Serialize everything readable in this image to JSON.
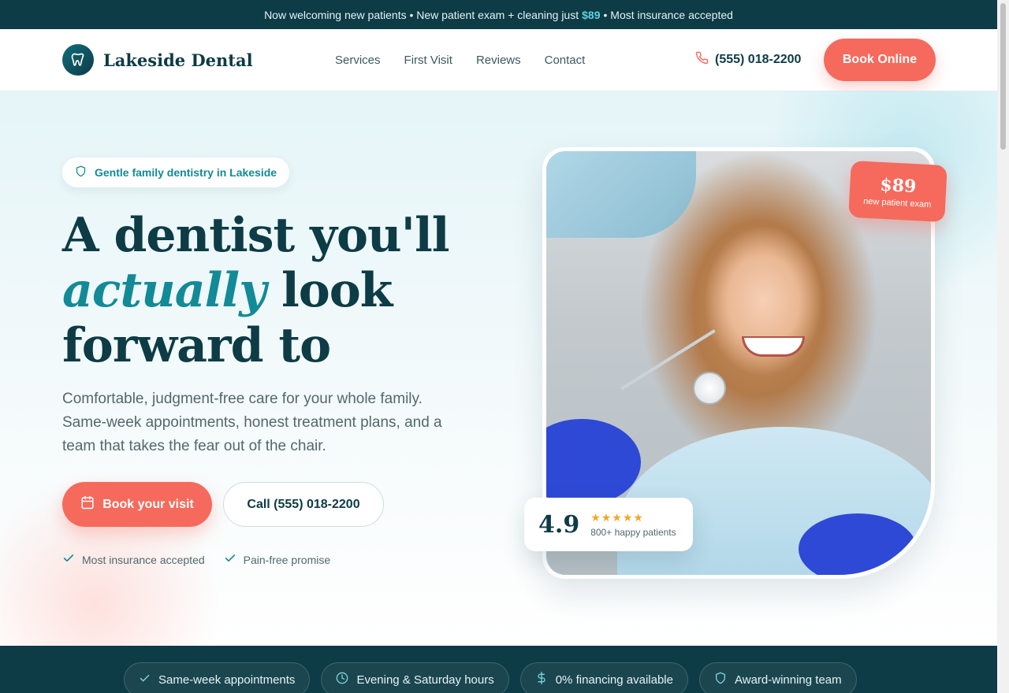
{
  "announcement": {
    "part1": "Now welcoming new patients • New patient exam + cleaning just",
    "price": "$89",
    "part2": "• Most insurance accepted"
  },
  "header": {
    "brand": "Lakeside Dental",
    "nav": [
      "Services",
      "First Visit",
      "Reviews",
      "Contact"
    ],
    "phone": "(555) 018-2200",
    "book_label": "Book Online"
  },
  "hero": {
    "pill": "Gentle family dentistry in Lakeside",
    "headline_line1": "A dentist you'll",
    "headline_accent": "actually",
    "headline_line2_rest": " look",
    "headline_line3": "forward to",
    "lead": "Comfortable, judgment-free care for your whole family. Same-week appointments, honest treatment plans, and a team that takes the fear out of the chair.",
    "cta_primary": "Book your visit",
    "cta_secondary": "Call (555) 018-2200",
    "checks": [
      "Most insurance accepted",
      "Pain-free promise"
    ]
  },
  "price_badge": {
    "amount": "$89",
    "label": "new patient exam"
  },
  "rating": {
    "score": "4.9",
    "stars": "★★★★★",
    "count": "800+ happy patients"
  },
  "features": [
    "Same-week appointments",
    "Evening & Saturday hours",
    "0% financing available",
    "Award-winning team"
  ],
  "colors": {
    "primary": "#0d3b46",
    "accent": "#138a97",
    "cta": "#f56a5c",
    "star": "#f3a62b"
  }
}
